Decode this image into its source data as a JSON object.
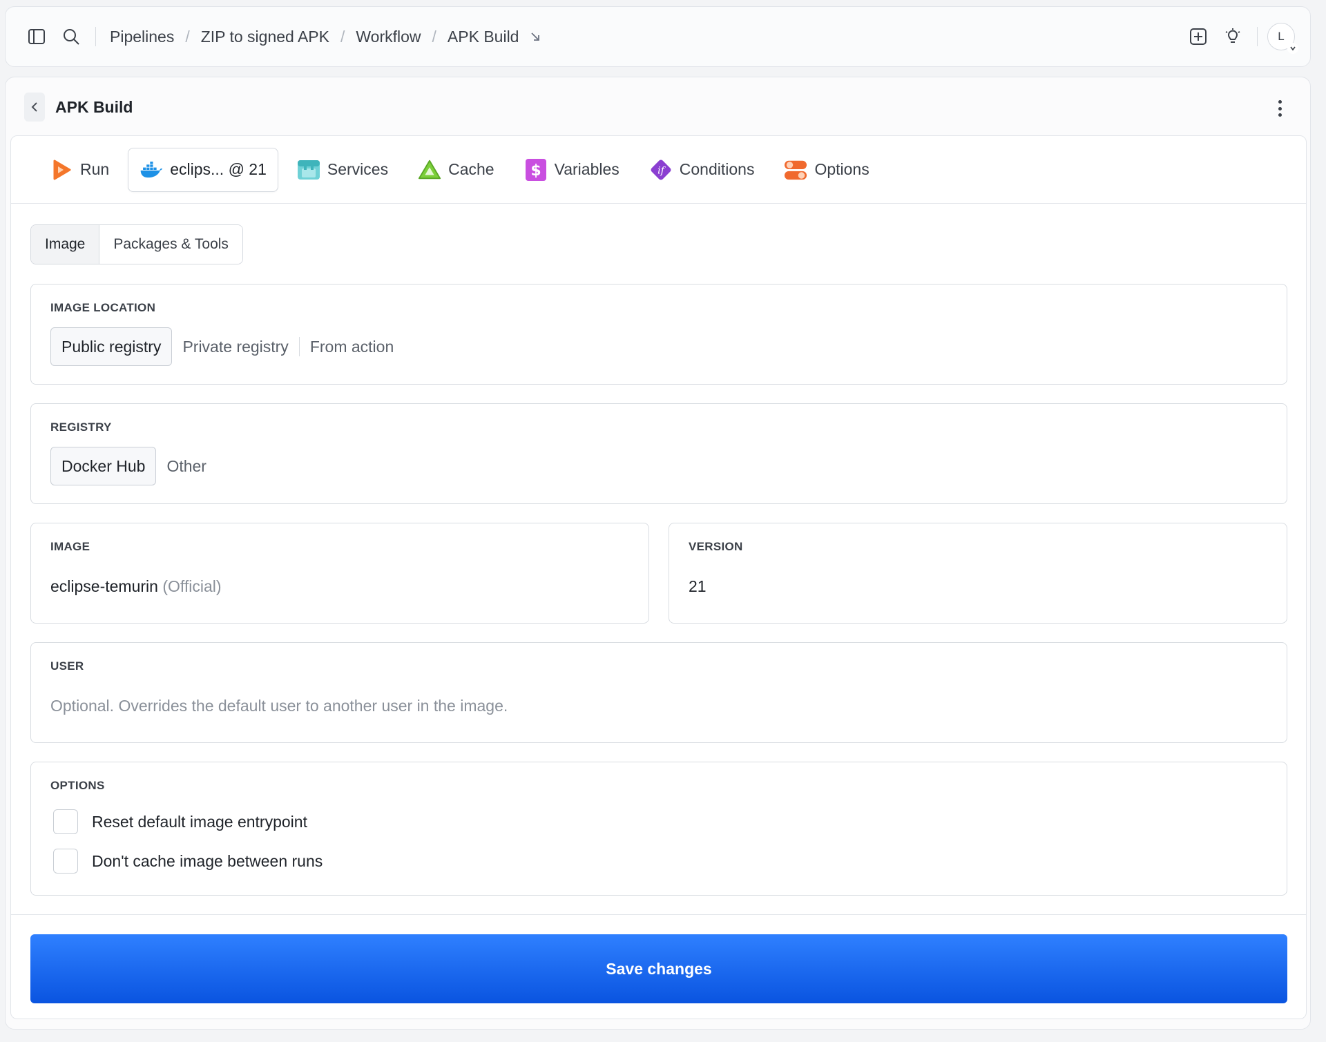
{
  "breadcrumb": [
    "Pipelines",
    "ZIP to signed APK",
    "Workflow",
    "APK Build"
  ],
  "avatar_initial": "L",
  "panel": {
    "title": "APK Build"
  },
  "tabs": [
    {
      "label": "Run",
      "icon": "run-icon"
    },
    {
      "label": "eclips... @ 21",
      "icon": "docker-icon",
      "active": true
    },
    {
      "label": "Services",
      "icon": "services-icon"
    },
    {
      "label": "Cache",
      "icon": "cache-icon"
    },
    {
      "label": "Variables",
      "icon": "variables-icon"
    },
    {
      "label": "Conditions",
      "icon": "conditions-icon"
    },
    {
      "label": "Options",
      "icon": "options-icon"
    }
  ],
  "subtabs": [
    {
      "label": "Image",
      "active": true
    },
    {
      "label": "Packages & Tools"
    }
  ],
  "image_location": {
    "label": "IMAGE LOCATION",
    "options": [
      "Public registry",
      "Private registry",
      "From action"
    ],
    "selected": "Public registry"
  },
  "registry": {
    "label": "REGISTRY",
    "options": [
      "Docker Hub",
      "Other"
    ],
    "selected": "Docker Hub"
  },
  "image": {
    "label": "IMAGE",
    "value": "eclipse-temurin",
    "tag": "(Official)"
  },
  "version": {
    "label": "VERSION",
    "value": "21"
  },
  "user": {
    "label": "USER",
    "placeholder": "Optional. Overrides the default user to another user in the image."
  },
  "options": {
    "label": "OPTIONS",
    "items": [
      {
        "label": "Reset default image entrypoint",
        "checked": false
      },
      {
        "label": "Don't cache image between runs",
        "checked": false
      }
    ]
  },
  "save_label": "Save changes",
  "colors": {
    "primary": "#0a5ce8",
    "run": "#f4762a",
    "docker": "#1d91e6",
    "services": "#4fc3c8",
    "cache": "#7ccf3a",
    "variables": "#c94fe0",
    "conditions": "#8b3fd1",
    "options": "#f0692e"
  }
}
